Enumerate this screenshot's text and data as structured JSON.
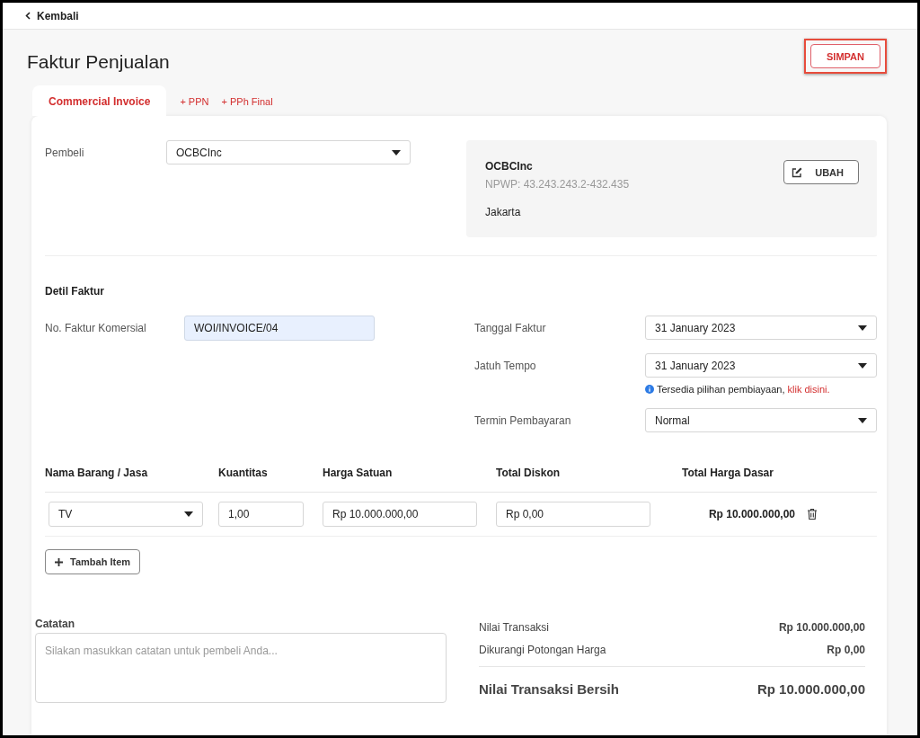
{
  "back_link": "Kembali",
  "title": "Faktur Penjualan",
  "save_button": "SIMPAN",
  "tabs": [
    {
      "label": "Commercial Invoice",
      "selected": true
    },
    {
      "label": "+ PPN",
      "selected": false
    },
    {
      "label": "+ PPh Final",
      "selected": false
    }
  ],
  "buyer": {
    "label": "Pembeli",
    "value": "OCBCInc",
    "name": "OCBCInc",
    "npwp": "NPWP: 43.243.243.2-432.435",
    "city": "Jakarta",
    "edit_button": "UBAH"
  },
  "detail": {
    "heading": "Detil Faktur",
    "left_fields": [
      {
        "label": "No. Faktur Komersial",
        "value": "WOI/INVOICE/04",
        "kind": "text"
      }
    ],
    "right_fields": [
      {
        "label": "Tanggal Faktur",
        "value": "31 January 2023",
        "kind": "select"
      },
      {
        "label": "Jatuh Tempo",
        "value": "31 January 2023",
        "kind": "select",
        "note": "Tersedia pilihan pembiayaan,",
        "note_link": "klik disini."
      },
      {
        "label": "Termin Pembayaran",
        "value": "Normal",
        "kind": "select"
      }
    ]
  },
  "items": {
    "columns": [
      "Nama Barang / Jasa",
      "Kuantitas",
      "Harga Satuan",
      "Total Diskon",
      "Total Harga Dasar"
    ],
    "rows": [
      {
        "name": "TV",
        "quantity": "1,00",
        "unit_price": "Rp 10.000.000,00",
        "discount": "Rp 0,00",
        "total": "Rp 10.000.000,00"
      }
    ],
    "add_button": "Tambah Item"
  },
  "notes": {
    "label": "Catatan",
    "placeholder": "Silakan masukkan catatan untuk pembeli Anda..."
  },
  "summary": {
    "rows": [
      {
        "label": "Nilai Transaksi",
        "value": "Rp 10.000.000,00"
      },
      {
        "label": "Dikurangi Potongan Harga",
        "value": "Rp 0,00"
      }
    ],
    "total_label": "Nilai Transaksi Bersih",
    "total_value": "Rp 10.000.000,00"
  }
}
